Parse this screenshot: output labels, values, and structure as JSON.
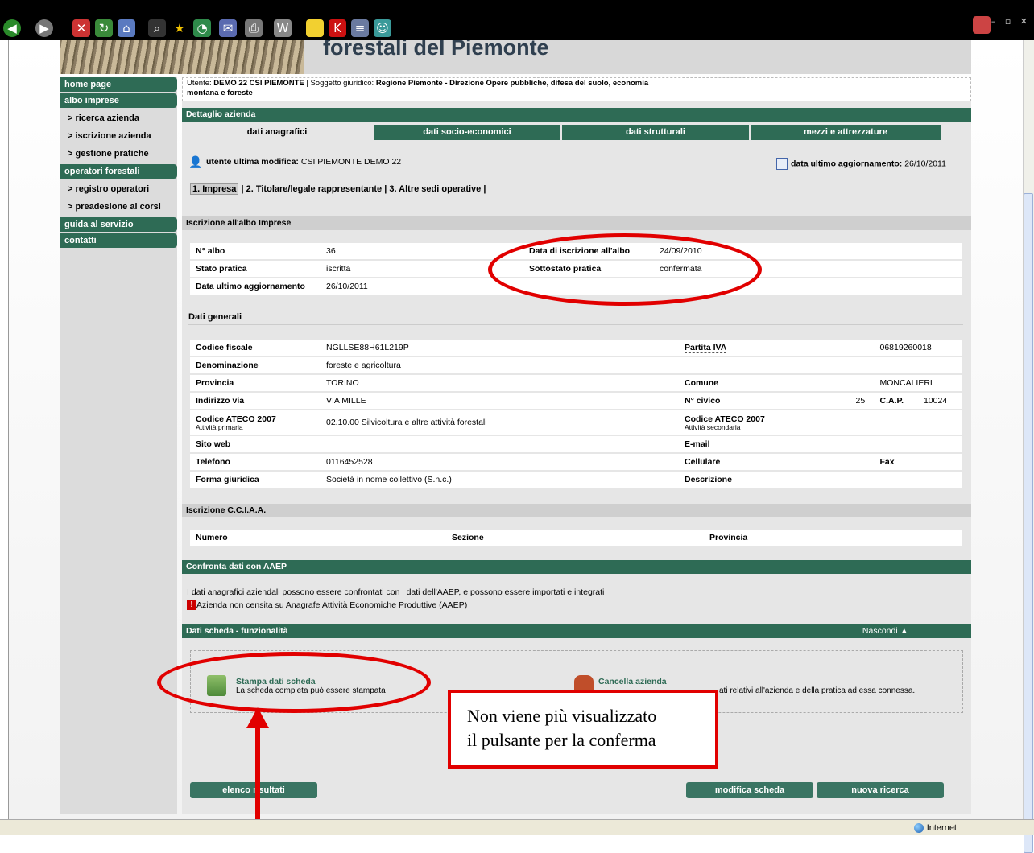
{
  "header": {
    "title": "forestali del Piemonte"
  },
  "user_bar": {
    "utente_label": "Utente:",
    "utente": "DEMO 22 CSI PIEMONTE",
    "soggetto_label": "| Soggetto giuridico:",
    "soggetto_line1": "Regione Piemonte - Direzione Opere pubbliche, difesa del suolo, economia",
    "soggetto_line2": "montana e foreste"
  },
  "sidebar": {
    "home": "home page",
    "albo": "albo imprese",
    "albo_items": [
      "> ricerca azienda",
      "> iscrizione azienda",
      "> gestione pratiche"
    ],
    "operatori": "operatori forestali",
    "operatori_items": [
      "> registro operatori",
      "> preadesione ai corsi"
    ],
    "guida": "guida al servizio",
    "contatti": "contatti"
  },
  "detail": {
    "title": "Dettaglio azienda",
    "tabs": [
      "dati anagrafici",
      "dati socio-economici",
      "dati strutturali",
      "mezzi e attrezzature"
    ],
    "last_user_label": "utente ultima modifica:",
    "last_user": "CSI PIEMONTE DEMO 22",
    "last_update_label": "data ultimo aggiornamento:",
    "last_update": "26/10/2011",
    "subnav": [
      "1. Impresa",
      "2. Titolare/legale rappresentante",
      "3. Altre sedi operative"
    ]
  },
  "iscrizione_albo": {
    "title": "Iscrizione all'albo Imprese",
    "n_albo_label": "N° albo",
    "n_albo": "36",
    "data_iscr_label": "Data di iscrizione all'albo",
    "data_iscr": "24/09/2010",
    "stato_label": "Stato pratica",
    "stato": "iscritta",
    "sottostato_label": "Sottostato pratica",
    "sottostato": "confermata",
    "agg_label": "Data ultimo aggiornamento",
    "agg": "26/10/2011"
  },
  "dati_generali": {
    "title": "Dati generali",
    "cf_label": "Codice fiscale",
    "cf": "NGLLSE88H61L219P",
    "iva_label": "Partita IVA",
    "iva": "06819260018",
    "denom_label": "Denominazione",
    "denom": "foreste e agricoltura",
    "prov_label": "Provincia",
    "prov": "TORINO",
    "comune_label": "Comune",
    "comune": "MONCALIERI",
    "via_label": "Indirizzo via",
    "via": "VIA MILLE",
    "civico_label": "N° civico",
    "civico": "25",
    "cap_label": "C.A.P.",
    "cap": "10024",
    "ateco_label": "Codice ATECO 2007",
    "ateco_prim": "Attività primaria",
    "ateco_value": "02.10.00 Silvicoltura e altre attività forestali",
    "ateco2_label": "Codice ATECO 2007",
    "ateco_sec": "Attività secondaria",
    "sito_label": "Sito web",
    "email_label": "E-mail",
    "tel_label": "Telefono",
    "tel": "0116452528",
    "cell_label": "Cellulare",
    "fax_label": "Fax",
    "forma_label": "Forma giuridica",
    "forma": "Società in nome collettivo (S.n.c.)",
    "descr_label": "Descrizione"
  },
  "cciaa": {
    "title": "Iscrizione C.C.I.A.A.",
    "numero": "Numero",
    "sezione": "Sezione",
    "provincia": "Provincia"
  },
  "aaep": {
    "title": "Confronta dati con AAEP",
    "text1": "I dati anagrafici aziendali possono essere confrontati con i dati dell'AAEP, e possono essere importati e integrati",
    "text2": "Azienda non censita su Anagrafe Attività Economiche Produttive (AAEP)"
  },
  "funzionalita": {
    "title": "Dati scheda - funzionalità",
    "nascondi": "Nascondi",
    "stampa_title": "Stampa dati scheda",
    "stampa_desc": "La scheda completa può essere stampata",
    "cancella_title": "Cancella azienda",
    "cancella_desc": "ati relativi all'azienda e della pratica ad essa connessa."
  },
  "buttons": {
    "elenco": "elenco risultati",
    "modifica": "modifica scheda",
    "nuova": "nuova ricerca"
  },
  "annotation": {
    "callout_line1": "Non viene più visualizzato",
    "callout_line2": "il pulsante per la conferma",
    "color": "#e10000"
  },
  "status": {
    "zone": "Internet"
  },
  "colors": {
    "accent": "#2e6b55"
  }
}
